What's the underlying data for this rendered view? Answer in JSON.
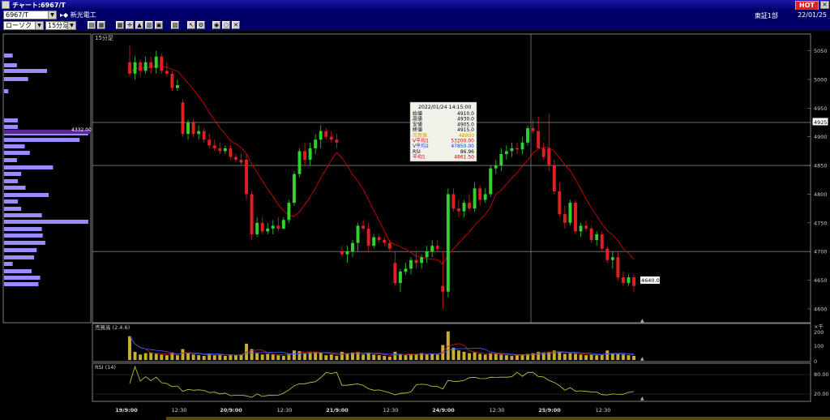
{
  "window": {
    "title": "チャート:6967/T",
    "hot": "HOT",
    "close": "×"
  },
  "header": {
    "code": "6967/T",
    "name": "新光電工",
    "market": "東証1部",
    "date": "22/01/25"
  },
  "controls": {
    "chart_type": "ローソク",
    "interval": "15分足"
  },
  "toolbar": {
    "icons": [
      "candle-icon",
      "volume-icon",
      "grid-icon",
      "crosshair-icon",
      "cursor-icon",
      "draw-icon",
      "zoom-in-icon",
      "zoom-out-icon",
      "print-icon",
      "reset-icon",
      "settings-icon",
      "color-icon",
      "help-icon"
    ]
  },
  "main": {
    "label": "15分足",
    "y_ticks": [
      5050,
      5000,
      4950,
      4900,
      4850,
      4800,
      4750,
      4700,
      4650,
      4600
    ],
    "price_box": "4925.0",
    "last_price_label": "4640.0",
    "vol_price_label": "4332.00"
  },
  "tooltip": {
    "datetime": "2022/01/24 14:15:00",
    "rows": [
      {
        "label": "始値",
        "value": "4910.0",
        "color": "#000000"
      },
      {
        "label": "高値",
        "value": "4930.0",
        "color": "#000000"
      },
      {
        "label": "安値",
        "value": "4905.0",
        "color": "#000000"
      },
      {
        "label": "終値",
        "value": "4915.0",
        "color": "#000000"
      },
      {
        "label": "売買高",
        "value": "48900",
        "color": "#c8a000"
      },
      {
        "label": "V平均1",
        "value": "53200.00",
        "color": "#d00000"
      },
      {
        "label": "V平均2",
        "value": "47850.00",
        "color": "#0040d0"
      },
      {
        "label": "RSI",
        "value": "86.96",
        "color": "#000000"
      },
      {
        "label": "平均1",
        "value": "4861.50",
        "color": "#d00000"
      }
    ]
  },
  "volume_panel": {
    "title": "売買高 (2.4.6)",
    "unit": "×千",
    "y_ticks": [
      "200",
      "100",
      "0"
    ]
  },
  "rsi_panel": {
    "title": "RSI (14)",
    "y_ticks": [
      "80.00",
      "20.00"
    ]
  },
  "x_labels": [
    {
      "text": "19/9:00",
      "bold": true
    },
    {
      "text": "12:30",
      "bold": false
    },
    {
      "text": "20/9:00",
      "bold": true
    },
    {
      "text": "12:30",
      "bold": false
    },
    {
      "text": "21/9:00",
      "bold": true
    },
    {
      "text": "12:30",
      "bold": false
    },
    {
      "text": "24/9:00",
      "bold": true
    },
    {
      "text": "12:30",
      "bold": false
    },
    {
      "text": "25/9:00",
      "bold": true
    },
    {
      "text": "12:30",
      "bold": false
    }
  ],
  "chart_data": {
    "type": "candlestick",
    "y_range": [
      4590,
      5065
    ],
    "volume_range": [
      0,
      250
    ],
    "rsi_range": [
      0,
      100
    ],
    "candles": [
      [
        5030,
        5060,
        5005,
        5010,
        175
      ],
      [
        5010,
        5040,
        5000,
        5030,
        60
      ],
      [
        5030,
        5035,
        5005,
        5015,
        40
      ],
      [
        5015,
        5040,
        5010,
        5030,
        50
      ],
      [
        5030,
        5040,
        5010,
        5020,
        55
      ],
      [
        5020,
        5050,
        5010,
        5040,
        45
      ],
      [
        5040,
        5045,
        5010,
        5015,
        40
      ],
      [
        5015,
        5030,
        5005,
        5010,
        35
      ],
      [
        5010,
        5015,
        4980,
        4985,
        55
      ],
      [
        4985,
        5000,
        4980,
        4990,
        35
      ],
      [
        4960,
        4965,
        4900,
        4905,
        80
      ],
      [
        4905,
        4930,
        4895,
        4925,
        50
      ],
      [
        4925,
        4930,
        4900,
        4905,
        40
      ],
      [
        4905,
        4920,
        4895,
        4910,
        35
      ],
      [
        4910,
        4915,
        4890,
        4895,
        30
      ],
      [
        4895,
        4905,
        4880,
        4885,
        45
      ],
      [
        4885,
        4895,
        4875,
        4880,
        35
      ],
      [
        4880,
        4890,
        4870,
        4875,
        40
      ],
      [
        4875,
        4885,
        4870,
        4880,
        30
      ],
      [
        4880,
        4885,
        4860,
        4865,
        40
      ],
      [
        4865,
        4870,
        4855,
        4860,
        35
      ],
      [
        4860,
        4870,
        4850,
        4855,
        40
      ],
      [
        4860,
        4870,
        4790,
        4800,
        120
      ],
      [
        4800,
        4805,
        4720,
        4730,
        80
      ],
      [
        4730,
        4760,
        4725,
        4750,
        50
      ],
      [
        4750,
        4760,
        4730,
        4735,
        40
      ],
      [
        4735,
        4750,
        4730,
        4740,
        45
      ],
      [
        4740,
        4755,
        4730,
        4745,
        40
      ],
      [
        4745,
        4760,
        4735,
        4740,
        35
      ],
      [
        4740,
        4760,
        4738,
        4755,
        30
      ],
      [
        4755,
        4790,
        4750,
        4785,
        45
      ],
      [
        4785,
        4840,
        4780,
        4835,
        70
      ],
      [
        4835,
        4880,
        4830,
        4875,
        65
      ],
      [
        4875,
        4890,
        4850,
        4860,
        50
      ],
      [
        4860,
        4890,
        4850,
        4880,
        55
      ],
      [
        4880,
        4905,
        4870,
        4895,
        60
      ],
      [
        4895,
        4920,
        4880,
        4910,
        55
      ],
      [
        4910,
        4915,
        4895,
        4900,
        35
      ],
      [
        4900,
        4910,
        4890,
        4895,
        40
      ],
      [
        4895,
        4905,
        4880,
        4890,
        30
      ],
      [
        4700,
        4710,
        4690,
        4695,
        60
      ],
      [
        4695,
        4710,
        4680,
        4700,
        50
      ],
      [
        4700,
        4720,
        4690,
        4715,
        55
      ],
      [
        4715,
        4750,
        4700,
        4745,
        60
      ],
      [
        4745,
        4755,
        4735,
        4740,
        40
      ],
      [
        4740,
        4750,
        4700,
        4710,
        55
      ],
      [
        4710,
        4730,
        4705,
        4725,
        40
      ],
      [
        4725,
        4730,
        4715,
        4720,
        35
      ],
      [
        4720,
        4725,
        4710,
        4715,
        30
      ],
      [
        4715,
        4720,
        4700,
        4705,
        25
      ],
      [
        4680,
        4700,
        4640,
        4645,
        60
      ],
      [
        4645,
        4670,
        4630,
        4665,
        45
      ],
      [
        4665,
        4680,
        4660,
        4670,
        35
      ],
      [
        4670,
        4690,
        4660,
        4685,
        40
      ],
      [
        4685,
        4700,
        4670,
        4680,
        45
      ],
      [
        4680,
        4695,
        4670,
        4690,
        50
      ],
      [
        4690,
        4710,
        4680,
        4700,
        40
      ],
      [
        4700,
        4720,
        4690,
        4710,
        45
      ],
      [
        4710,
        4720,
        4700,
        4705,
        40
      ],
      [
        4640,
        4700,
        4600,
        4630,
        110
      ],
      [
        4630,
        4810,
        4620,
        4800,
        210
      ],
      [
        4800,
        4810,
        4770,
        4775,
        90
      ],
      [
        4775,
        4790,
        4760,
        4770,
        70
      ],
      [
        4770,
        4790,
        4760,
        4785,
        60
      ],
      [
        4785,
        4800,
        4770,
        4775,
        50
      ],
      [
        4775,
        4820,
        4770,
        4810,
        55
      ],
      [
        4810,
        4815,
        4780,
        4790,
        45
      ],
      [
        4790,
        4810,
        4785,
        4800,
        40
      ],
      [
        4800,
        4850,
        4795,
        4845,
        50
      ],
      [
        4845,
        4860,
        4835,
        4850,
        45
      ],
      [
        4850,
        4880,
        4840,
        4870,
        40
      ],
      [
        4870,
        4885,
        4860,
        4875,
        35
      ],
      [
        4875,
        4890,
        4865,
        4880,
        30
      ],
      [
        4880,
        4890,
        4870,
        4878,
        35
      ],
      [
        4878,
        4900,
        4870,
        4890,
        40
      ],
      [
        4890,
        4920,
        4885,
        4915,
        45
      ],
      [
        4915,
        4930,
        4905,
        4910,
        50
      ],
      [
        4910,
        4935,
        4890,
        4880,
        60
      ],
      [
        4880,
        4890,
        4860,
        4865,
        55
      ],
      [
        4880,
        4940,
        4840,
        4850,
        60
      ],
      [
        4850,
        4860,
        4800,
        4805,
        70
      ],
      [
        4805,
        4820,
        4760,
        4765,
        60
      ],
      [
        4765,
        4780,
        4740,
        4750,
        45
      ],
      [
        4750,
        4790,
        4745,
        4785,
        50
      ],
      [
        4785,
        4790,
        4730,
        4735,
        45
      ],
      [
        4735,
        4750,
        4725,
        4745,
        40
      ],
      [
        4745,
        4755,
        4735,
        4740,
        35
      ],
      [
        4740,
        4745,
        4715,
        4720,
        40
      ],
      [
        4720,
        4735,
        4710,
        4730,
        35
      ],
      [
        4730,
        4735,
        4700,
        4705,
        40
      ],
      [
        4705,
        4710,
        4680,
        4685,
        70
      ],
      [
        4685,
        4700,
        4670,
        4690,
        50
      ],
      [
        4690,
        4700,
        4650,
        4655,
        45
      ],
      [
        4655,
        4665,
        4640,
        4645,
        40
      ],
      [
        4645,
        4660,
        4640,
        4655,
        35
      ],
      [
        4655,
        4660,
        4630,
        4640,
        30
      ]
    ]
  }
}
